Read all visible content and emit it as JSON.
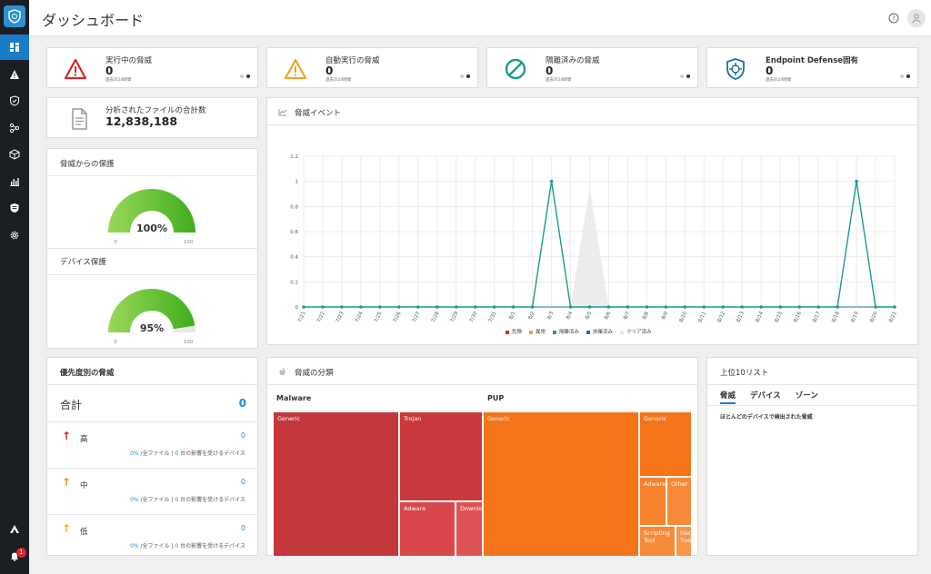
{
  "header": {
    "title": "ダッシュボード"
  },
  "sidebar": {
    "badge_count": "1"
  },
  "stats": [
    {
      "title": "実行中の脅威",
      "value": "0",
      "sub": "過去の24時間",
      "icon": "warning-red-icon",
      "color": "#d9262c"
    },
    {
      "title": "自動実行の脅威",
      "value": "0",
      "sub": "過去の24時間",
      "icon": "warning-orange-icon",
      "color": "#f0a32a"
    },
    {
      "title": "隔離済みの脅威",
      "value": "0",
      "sub": "過去の24時間",
      "icon": "blocked-icon",
      "color": "#1a9c8c"
    },
    {
      "title": "Endpoint Defense固有",
      "value": "0",
      "sub": "過去の24時間",
      "icon": "shield-target-icon",
      "color": "#1a6fb0"
    }
  ],
  "files": {
    "title": "分析されたファイルの合計数",
    "value": "12,838,188"
  },
  "protection": {
    "title": "脅威からの保護",
    "threat_gauge": {
      "value_label": "100%",
      "percent": 100,
      "min": "0",
      "max": "100"
    },
    "device_title": "デバイス保護",
    "device_gauge": {
      "value_label": "95%",
      "percent": 95,
      "min": "0",
      "max": "100"
    }
  },
  "events": {
    "title": "脅威イベント",
    "chart_data": {
      "type": "line",
      "title": "脅威イベント",
      "x": [
        "7/21",
        "7/22",
        "7/23",
        "7/24",
        "7/25",
        "7/26",
        "7/27",
        "7/28",
        "7/29",
        "7/30",
        "7/31",
        "8/1",
        "8/2",
        "8/3",
        "8/4",
        "8/5",
        "8/6",
        "8/7",
        "8/8",
        "8/9",
        "8/10",
        "8/11",
        "8/12",
        "8/13",
        "8/14",
        "8/15",
        "8/16",
        "8/17",
        "8/18",
        "8/19",
        "8/20",
        "8/21"
      ],
      "y_ticks": [
        "0",
        "0.2",
        "0.4",
        "0.6",
        "0.8",
        "1",
        "1.2"
      ],
      "ylim": [
        0,
        1.2
      ],
      "legend_placement": "bottom",
      "series": [
        {
          "name": "危険",
          "color": "#d9262c",
          "values": [
            0,
            0,
            0,
            0,
            0,
            0,
            0,
            0,
            0,
            0,
            0,
            0,
            0,
            0,
            0,
            0,
            0,
            0,
            0,
            0,
            0,
            0,
            0,
            0,
            0,
            0,
            0,
            0,
            0,
            0,
            0,
            0
          ]
        },
        {
          "name": "異常",
          "color": "#f0a32a",
          "values": [
            0,
            0,
            0,
            0,
            0,
            0,
            0,
            0,
            0,
            0,
            0,
            0,
            0,
            0,
            0,
            0,
            0,
            0,
            0,
            0,
            0,
            0,
            0,
            0,
            0,
            0,
            0,
            0,
            0,
            0,
            0,
            0
          ]
        },
        {
          "name": "隔離済み",
          "color": "#1a9c8c",
          "values": [
            0,
            0,
            0,
            0,
            0,
            0,
            0,
            0,
            0,
            0,
            0,
            0,
            0,
            1,
            0,
            0,
            0,
            0,
            0,
            0,
            0,
            0,
            0,
            0,
            0,
            0,
            0,
            0,
            0,
            1,
            0,
            0
          ]
        },
        {
          "name": "放棄済み",
          "color": "#1a6fb0",
          "values": [
            0,
            0,
            0,
            0,
            0,
            0,
            0,
            0,
            0,
            0,
            0,
            0,
            0,
            0,
            0,
            0,
            0,
            0,
            0,
            0,
            0,
            0,
            0,
            0,
            0,
            0,
            0,
            0,
            0,
            0,
            0,
            0
          ]
        },
        {
          "name": "クリア済み",
          "color": "#e8e8e8",
          "values": [
            0,
            0,
            0,
            0,
            0,
            0,
            0,
            0,
            0,
            0,
            0,
            0,
            0,
            0,
            0,
            0.95,
            0,
            0,
            0,
            0,
            0,
            0,
            0,
            0,
            0,
            0,
            0,
            0,
            0,
            0,
            0,
            0
          ]
        }
      ]
    }
  },
  "priority": {
    "title": "優先度別の脅威",
    "total_label": "合計",
    "total_value": "0",
    "rows": [
      {
        "name": "高",
        "value": "0",
        "pct": "0%",
        "files": "/全ファイル",
        "sep": "|",
        "devices": "0",
        "devices_text": "台の影響を受けるデバイス",
        "color": "#d9262c"
      },
      {
        "name": "中",
        "value": "0",
        "pct": "0%",
        "files": "/全ファイル",
        "sep": "|",
        "devices": "0",
        "devices_text": "台の影響を受けるデバイス",
        "color": "#f08a2a"
      },
      {
        "name": "低",
        "value": "0",
        "pct": "0%",
        "files": "/全ファイル",
        "sep": "|",
        "devices": "0",
        "devices_text": "台の影響を受けるデバイス",
        "color": "#f0b02a"
      }
    ]
  },
  "classification": {
    "title": "脅威の分類",
    "groups": [
      "Malware",
      "PUP"
    ],
    "cells": [
      "Generic",
      "Trojan",
      "Adware",
      "Downlo",
      "Generic",
      "Generic",
      "Adware",
      "Other",
      "Scripting Tool",
      "Hack Tool"
    ]
  },
  "top10": {
    "title": "上位10リスト",
    "tabs": [
      "脅威",
      "デバイス",
      "ゾーン"
    ],
    "note": "ほとんどのデバイスで検出された脅威"
  }
}
